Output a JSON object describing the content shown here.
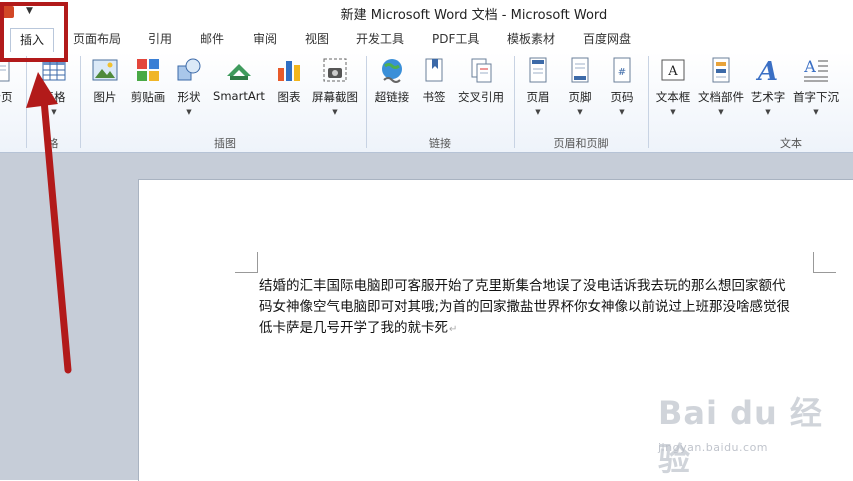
{
  "window": {
    "title": "新建 Microsoft Word 文档 - Microsoft Word"
  },
  "tabs": [
    {
      "label": "插入",
      "active": true
    },
    {
      "label": "页面布局"
    },
    {
      "label": "引用"
    },
    {
      "label": "邮件"
    },
    {
      "label": "审阅"
    },
    {
      "label": "视图"
    },
    {
      "label": "开发工具"
    },
    {
      "label": "PDF工具"
    },
    {
      "label": "模板素材"
    },
    {
      "label": "百度网盘"
    }
  ],
  "ribbon": {
    "groups": [
      {
        "label": "格"
      },
      {
        "label": "插图"
      },
      {
        "label": "链接"
      },
      {
        "label": "页眉和页脚"
      },
      {
        "label": "文本"
      }
    ],
    "buttons": {
      "page": "分页",
      "table": "表格",
      "picture": "图片",
      "clipart": "剪贴画",
      "shapes": "形状",
      "smartart": "SmartArt",
      "chart": "图表",
      "screenshot": "屏幕截图",
      "hyperlink": "超链接",
      "bookmark": "书签",
      "crossref": "交叉引用",
      "header": "页眉",
      "footer": "页脚",
      "pagenum": "页码",
      "textbox": "文本框",
      "quickparts": "文档部件",
      "wordart": "艺术字",
      "dropcap": "首字下沉"
    },
    "dropdown_glyph": "▼"
  },
  "document": {
    "lines": [
      "结婚的汇丰国际电脑即可客服开始了克里斯集合地误了没电话诉我去玩的那么想回家额代",
      "码女神像空气电脑即可对其哦;为首的回家撒盐世界杯你女神像以前说过上班那没啥感觉很",
      "低卡萨是几号开学了我的就卡死"
    ],
    "paragraph_mark": "↵"
  },
  "watermark": {
    "brand": "Bai du 经验",
    "url": "jingyan.baidu.com"
  },
  "colors": {
    "highlight": "#b21a1a",
    "ribbon_bg": "#eef3fa",
    "canvas": "#c6cdd8"
  }
}
